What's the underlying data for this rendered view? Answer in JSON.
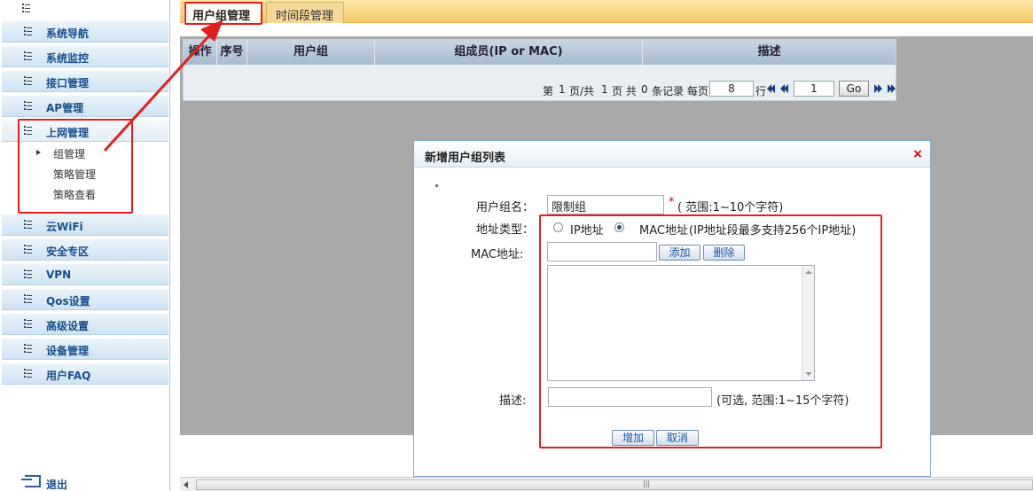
{
  "sidebar": {
    "items": [
      {
        "label": "系统导航"
      },
      {
        "label": "系统监控"
      },
      {
        "label": "接口管理"
      },
      {
        "label": "AP管理"
      },
      {
        "label": "上网管理"
      },
      {
        "label": "云WiFi"
      },
      {
        "label": "安全专区"
      },
      {
        "label": "VPN"
      },
      {
        "label": "Qos设置"
      },
      {
        "label": "高级设置"
      },
      {
        "label": "设备管理"
      },
      {
        "label": "用户FAQ"
      }
    ],
    "subitems": [
      {
        "label": "组管理"
      },
      {
        "label": "策略管理"
      },
      {
        "label": "策略查看"
      }
    ],
    "logout_label": "退出"
  },
  "tabs": [
    {
      "label": "用户组管理"
    },
    {
      "label": "时间段管理"
    }
  ],
  "grid": {
    "columns": [
      "操作",
      "序号",
      "用户组",
      "组成员(IP or MAC)",
      "描述"
    ]
  },
  "pager": {
    "page_prefix": "第",
    "current_page": "1",
    "total_pages_text": "页/共",
    "total_pages": "1",
    "records_text": "页 共",
    "records": "0",
    "records_suffix": "条记录 每页",
    "per_page_value": "8",
    "per_page_suffix": "行",
    "goto_page_value": "1",
    "go_label": "Go"
  },
  "dialog": {
    "title": "新增用户组列表",
    "close_icon": "×",
    "group_name_label": "用户组名：",
    "group_name_value": "限制组",
    "group_name_required": "*",
    "group_name_hint": "( 范围:1~10个字符)",
    "addr_type_label": "地址类型：",
    "ip_option": "IP地址",
    "mac_option": "MAC地址",
    "mac_option_hint": "(IP地址段最多支持256个IP地址)",
    "selected_option": "mac",
    "mac_label": "MAC地址:",
    "mac_input_value": "",
    "add_button": "添加",
    "delete_button": "删除",
    "desc_label": "描述:",
    "desc_value": "",
    "desc_hint": "(可选, 范围:1~15个字符)",
    "submit_button": "增加",
    "cancel_button": "取消"
  },
  "colors": {
    "annotation_red": "#e02020",
    "tab_bar": "#f6c96a",
    "header_blue": "#1a4d8c"
  }
}
